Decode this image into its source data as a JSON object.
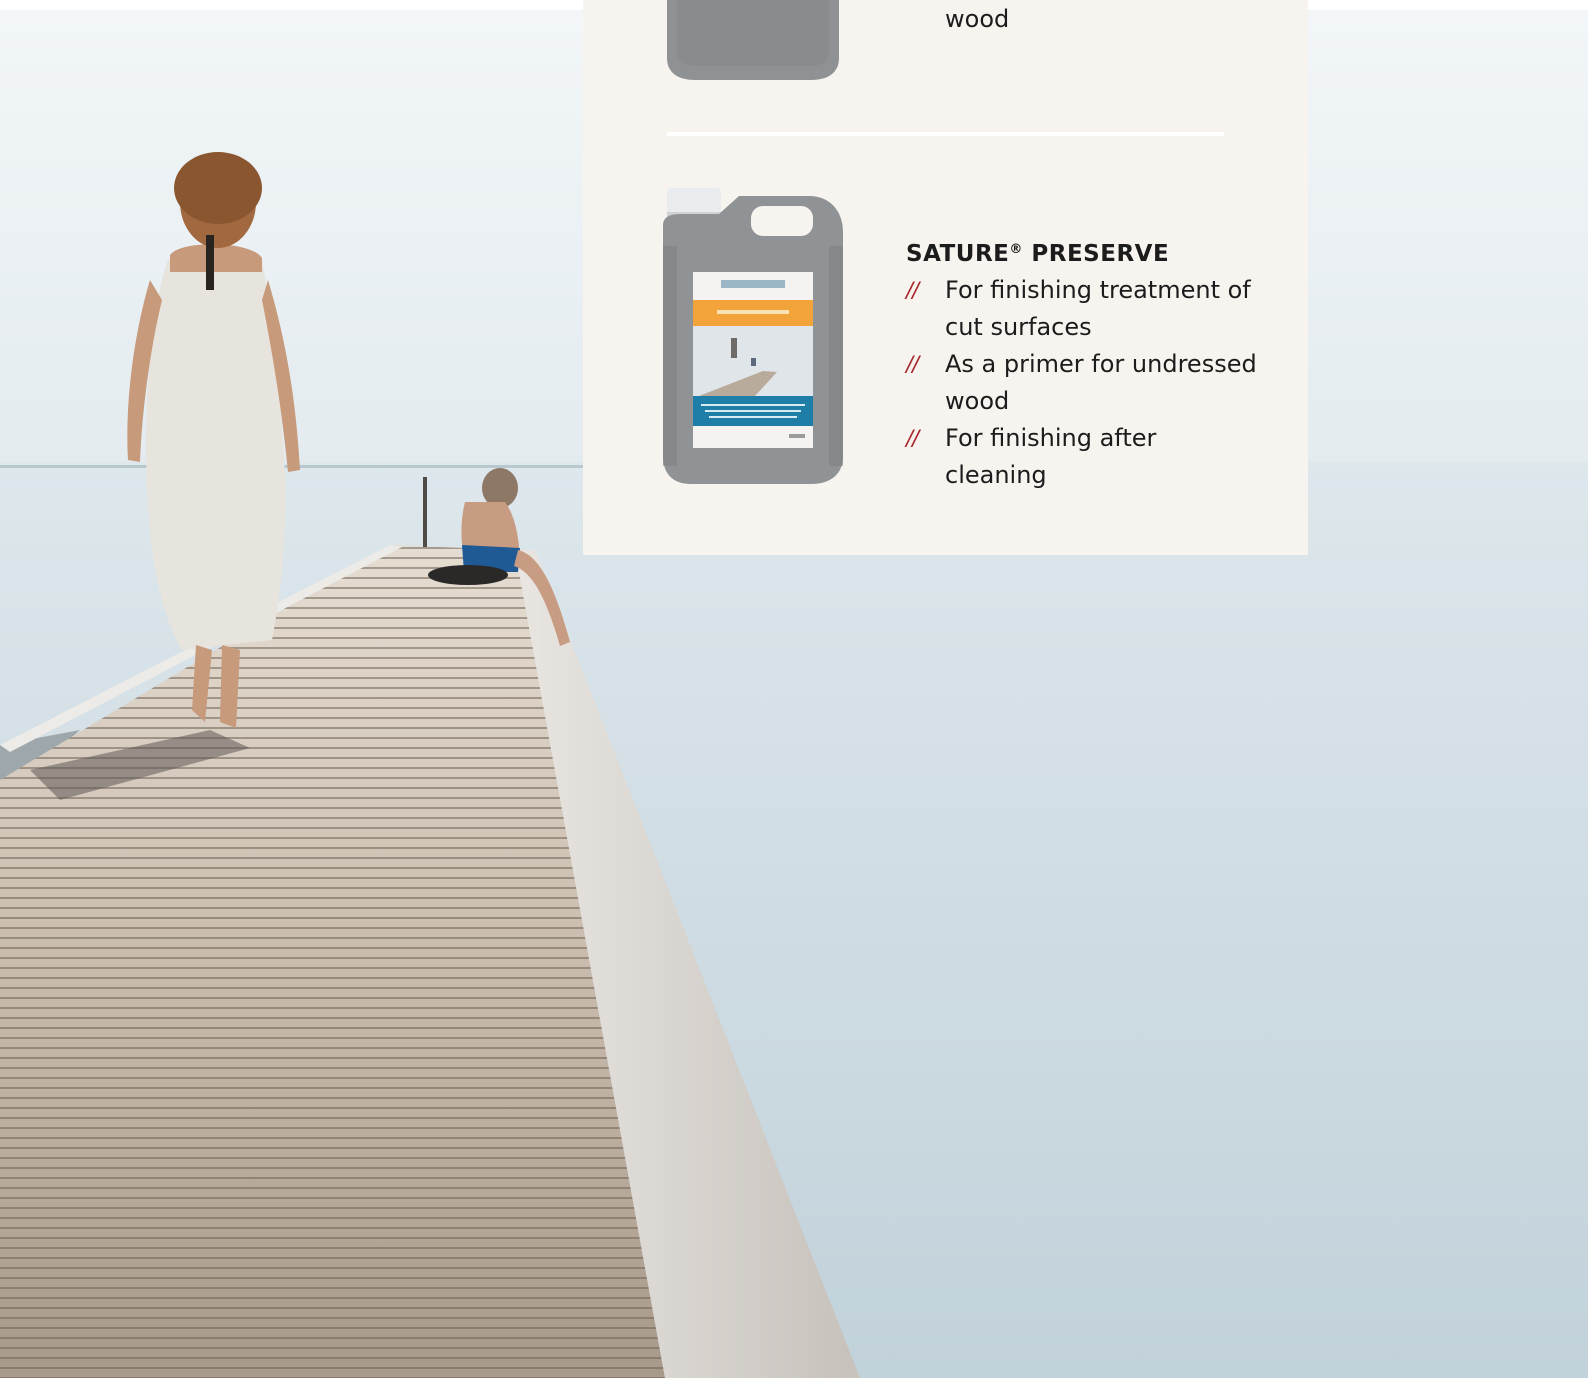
{
  "panel": {
    "tail_text": "wood",
    "product": {
      "title": "SATURE",
      "title_mark": "®",
      "title_suffix": " PRESERVE",
      "bullet_mark": "//",
      "bullets": [
        "For finishing treatment of cut surfaces",
        "As a primer for undressed wood",
        "For finishing after cleaning"
      ]
    }
  },
  "colors": {
    "panel_bg": "#f7f4f0",
    "accent": "#a6262a",
    "text": "#1c1c1c",
    "label_orange": "#f2a43a",
    "label_blue": "#1f7ea8",
    "jug_gray": "#8a8d90"
  }
}
